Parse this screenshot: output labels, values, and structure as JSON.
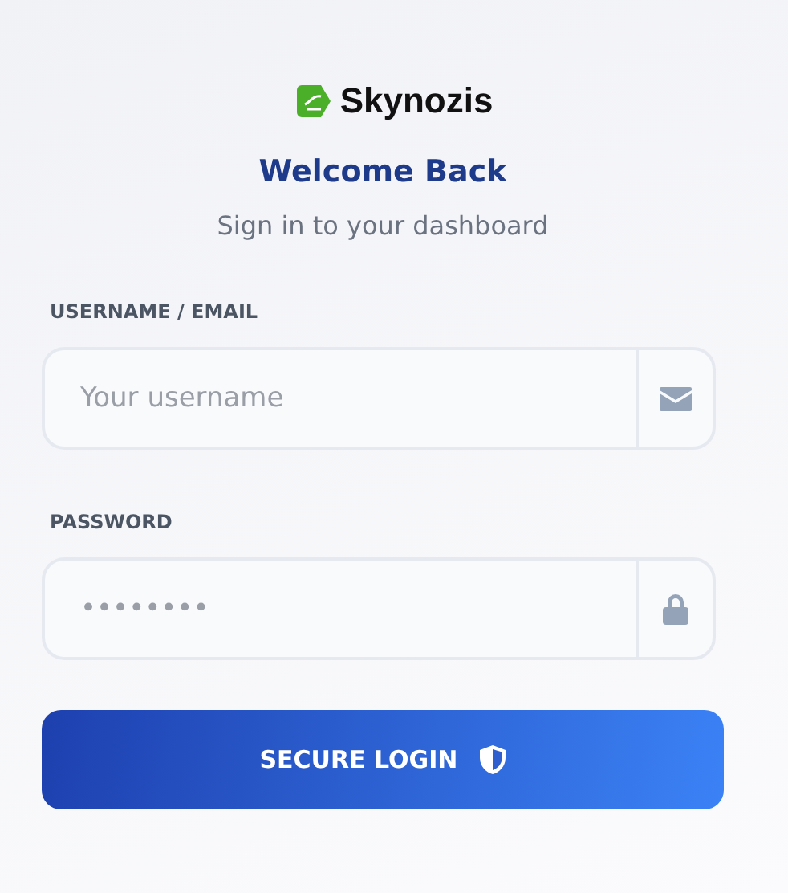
{
  "brand": {
    "name": "Skynozis"
  },
  "title": "Welcome Back",
  "subtitle": "Sign in to your dashboard",
  "fields": [
    {
      "label": "USERNAME / EMAIL",
      "placeholder": "Your username",
      "kind": "text"
    },
    {
      "label": "PASSWORD",
      "placeholder": "••••••••",
      "kind": "password"
    }
  ],
  "submit": {
    "label": "SECURE LOGIN"
  }
}
